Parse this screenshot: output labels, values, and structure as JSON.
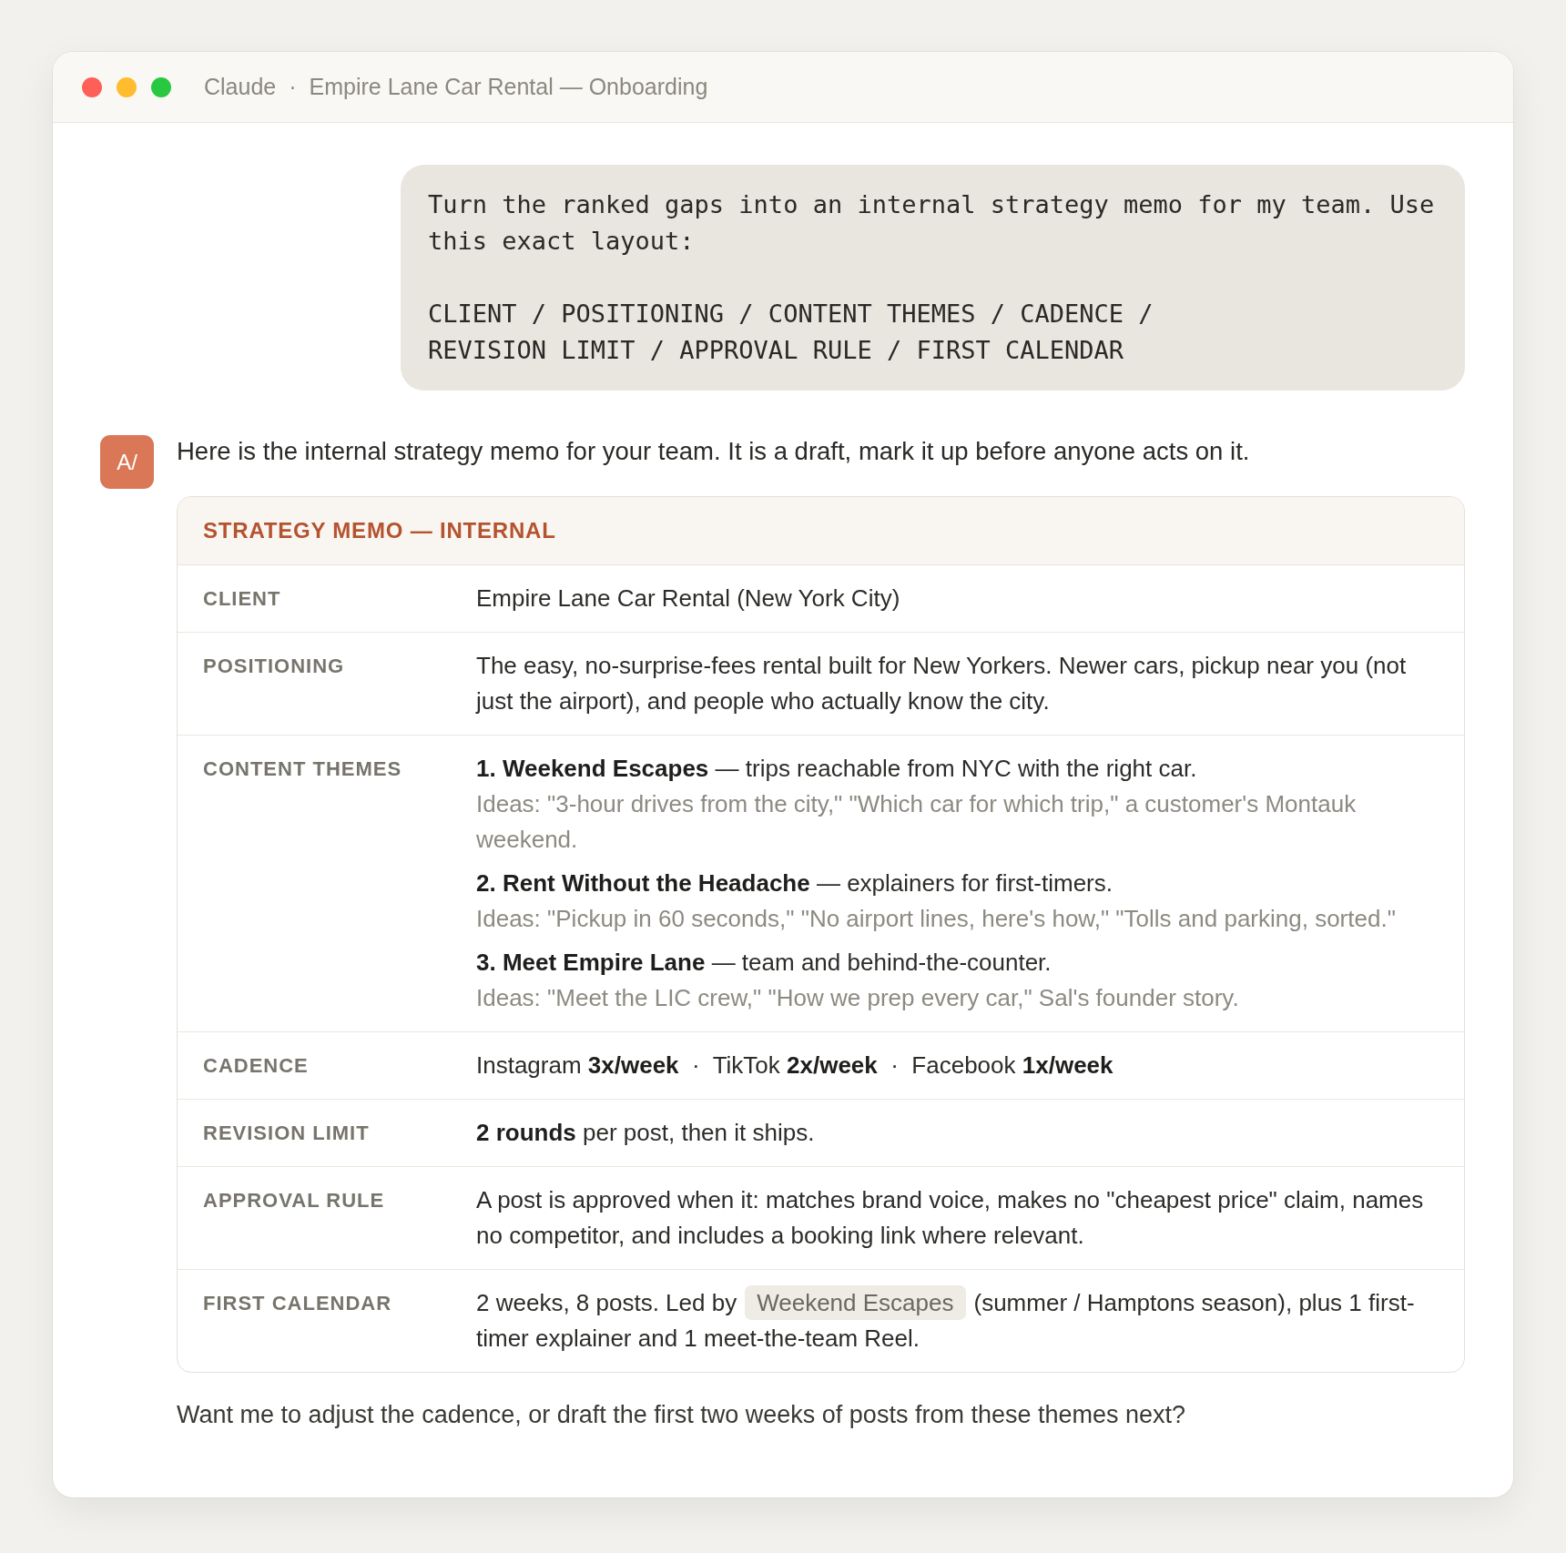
{
  "window": {
    "app_name": "Claude",
    "separator": "·",
    "title": "Empire Lane Car Rental — Onboarding"
  },
  "user_message": {
    "paragraphs": [
      "Turn the ranked gaps into an internal strategy memo for my team. Use this exact layout:"
    ],
    "layout_lines": [
      "CLIENT / POSITIONING / CONTENT THEMES / CADENCE /",
      "REVISION LIMIT / APPROVAL RULE / FIRST CALENDAR"
    ]
  },
  "assistant": {
    "avatar": "A/",
    "intro": "Here is the internal strategy memo for your team. It is a draft, mark it up before anyone acts on it.",
    "memo": {
      "title": "STRATEGY MEMO — INTERNAL",
      "rows": [
        {
          "kind": "text",
          "label": "CLIENT",
          "value": "Empire Lane Car Rental (New York City)"
        },
        {
          "kind": "text",
          "label": "POSITIONING",
          "value": "The easy, no-surprise-fees rental built for New Yorkers. Newer cars, pickup near you (not just the airport), and people who actually know the city."
        },
        {
          "kind": "themes",
          "label": "CONTENT THEMES",
          "themes": [
            {
              "heading": "**1. Weekend Escapes** — trips reachable from NYC with the right car.",
              "ideas": "Ideas: \"3-hour drives from the city,\" \"Which car for which trip,\" a customer's Montauk weekend."
            },
            {
              "heading": "**2. Rent Without the Headache** — explainers for first-timers.",
              "ideas": "Ideas: \"Pickup in 60 seconds,\" \"No airport lines, here's how,\" \"Tolls and parking, sorted.\""
            },
            {
              "heading": "**3. Meet Empire Lane** — team and behind-the-counter.",
              "ideas": "Ideas: \"Meet the LIC crew,\" \"How we prep every car,\" Sal's founder story."
            }
          ]
        },
        {
          "kind": "text",
          "label": "CADENCE",
          "value": "Instagram **3x/week**  ·  TikTok **2x/week**  ·  Facebook **1x/week**"
        },
        {
          "kind": "text",
          "label": "REVISION LIMIT",
          "value": "**2 rounds** per post, then it ships."
        },
        {
          "kind": "text",
          "label": "APPROVAL RULE",
          "value": "A post is approved when it: matches brand voice, makes no \"cheapest price\" claim, names no competitor, and includes a booking link where relevant."
        },
        {
          "kind": "chip",
          "label": "FIRST CALENDAR",
          "before": "2 weeks, 8 posts. Led by",
          "chip": "Weekend Escapes",
          "after": "(summer / Hamptons season), plus 1 first-timer explainer and 1 meet-the-team Reel."
        }
      ]
    },
    "closing": "Want me to adjust the cadence, or draft the first two weeks of posts from these themes next?"
  }
}
